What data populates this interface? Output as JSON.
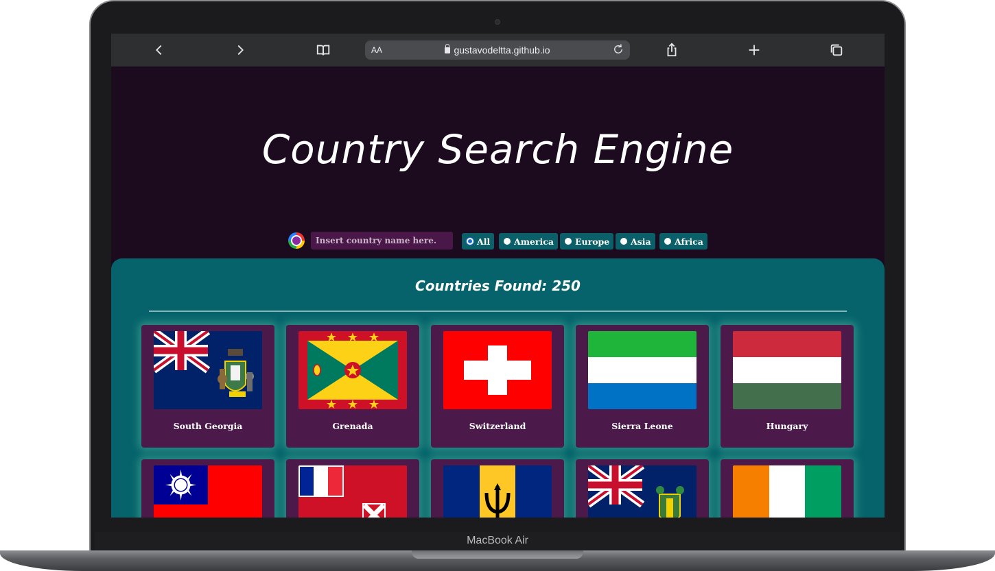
{
  "device": {
    "label": "MacBook Air"
  },
  "browser": {
    "text_size_label": "AA",
    "url": "gustavodeltta.github.io",
    "icons": [
      "back-icon",
      "forward-icon",
      "bookmarks-icon",
      "lock-icon",
      "reload-icon",
      "share-icon",
      "new-tab-icon",
      "tabs-icon"
    ]
  },
  "page": {
    "title": "Country Search Engine",
    "search": {
      "placeholder": "Insert country name here."
    },
    "filters": [
      {
        "label": "All",
        "checked": true
      },
      {
        "label": "America",
        "checked": false
      },
      {
        "label": "Europe",
        "checked": false
      },
      {
        "label": "Asia",
        "checked": false
      },
      {
        "label": "Africa",
        "checked": false
      }
    ],
    "results_label": "Countries Found: 250",
    "countries": [
      {
        "name": "South Georgia",
        "flag": "south-georgia-flag"
      },
      {
        "name": "Grenada",
        "flag": "grenada-flag"
      },
      {
        "name": "Switzerland",
        "flag": "switzerland-flag"
      },
      {
        "name": "Sierra Leone",
        "flag": "sierra-leone-flag"
      },
      {
        "name": "Hungary",
        "flag": "hungary-flag"
      },
      {
        "name": "",
        "flag": "taiwan-flag"
      },
      {
        "name": "",
        "flag": "wallis-futuna-flag"
      },
      {
        "name": "",
        "flag": "barbados-flag"
      },
      {
        "name": "",
        "flag": "pitcairn-flag"
      },
      {
        "name": "",
        "flag": "ivory-coast-flag"
      }
    ]
  },
  "colors": {
    "page_bg": "#1c0b1f",
    "panel_bg": "#06636b",
    "card_bg": "#4b1a4a",
    "pill_bg": "#0b5f68",
    "input_bg": "#4a1848"
  }
}
